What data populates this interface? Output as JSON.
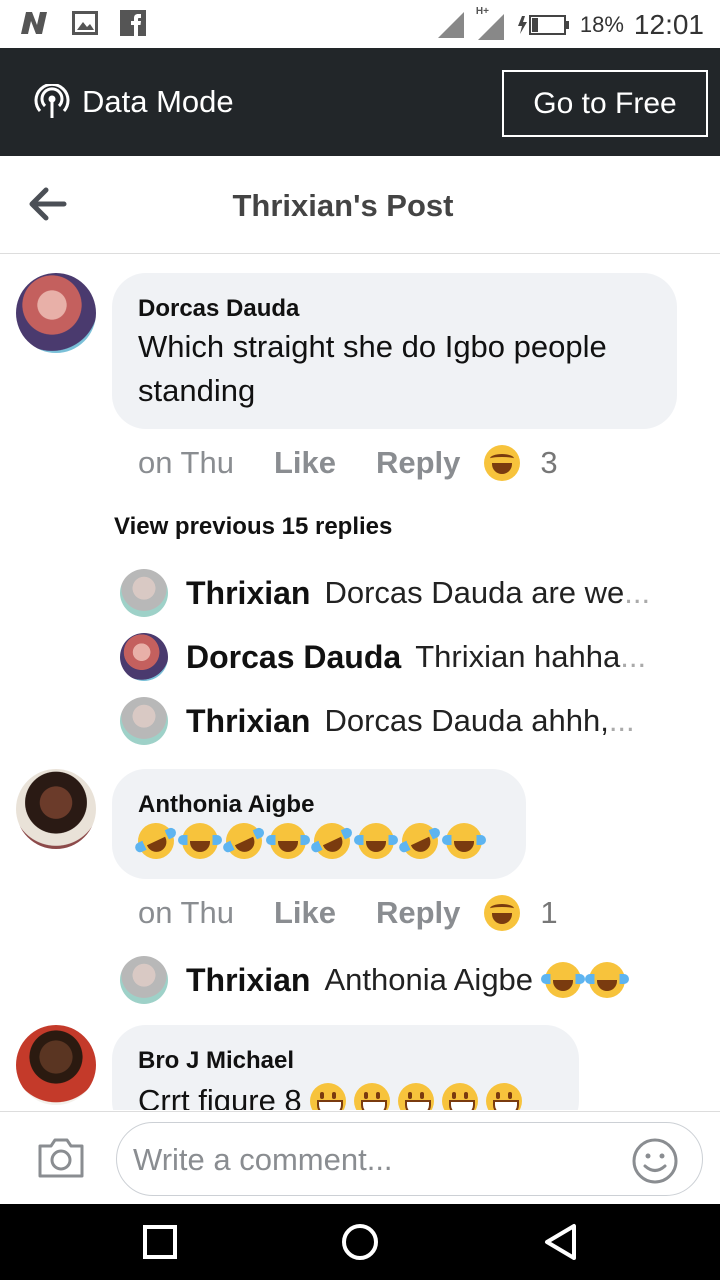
{
  "status_bar": {
    "battery": "18%",
    "time": "12:01",
    "network": "H+"
  },
  "data_bar": {
    "label": "Data Mode",
    "button": "Go to Free"
  },
  "header": {
    "title": "Thrixian's Post"
  },
  "comments": [
    {
      "author": "Dorcas Dauda",
      "text_lines": [
        "Which straight she do Igbo people",
        "standing"
      ],
      "time": "on Thu",
      "like": "Like",
      "reply": "Reply",
      "reaction_count": "3"
    },
    {
      "author": "Anthonia Aigbe",
      "time": "on Thu",
      "like": "Like",
      "reply": "Reply",
      "reaction_count": "1"
    },
    {
      "author": "Bro J Michael",
      "text": "Crrt figure 8"
    }
  ],
  "view_previous": "View previous 15 replies",
  "replies": [
    {
      "name": "Thrixian",
      "text": "Dorcas Dauda are we",
      "ellipsis": "..."
    },
    {
      "name": "Dorcas Dauda",
      "text": "Thrixian hahha",
      "ellipsis": "..."
    },
    {
      "name": "Thrixian",
      "text": "Dorcas Dauda ahhh,",
      "ellipsis": "..."
    },
    {
      "name": "Thrixian",
      "text": "Anthonia Aigbe"
    }
  ],
  "composer": {
    "placeholder": "Write a comment..."
  },
  "icons": {
    "back": "arrow-left-icon",
    "data_mode": "broadcast-icon",
    "camera": "camera-icon",
    "smile": "smiley-icon",
    "nav_recent": "square-icon",
    "nav_home": "circle-icon",
    "nav_back": "triangle-icon"
  },
  "colors": {
    "dark_bar": "#222629",
    "bubble": "#f0f2f5",
    "meta_text": "#8a8d91"
  }
}
